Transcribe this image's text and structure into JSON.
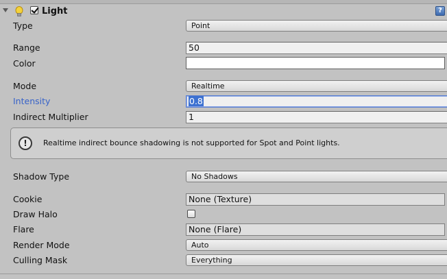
{
  "component": {
    "title": "Light",
    "enabled": true,
    "icon": "lightbulb-icon",
    "help_icon": "help-book-icon",
    "help_glyph": "?"
  },
  "fields": {
    "type": {
      "label": "Type",
      "value": "Point"
    },
    "range": {
      "label": "Range",
      "value": "50"
    },
    "color": {
      "label": "Color",
      "value": "#ffffff"
    },
    "mode": {
      "label": "Mode",
      "value": "Realtime"
    },
    "intensity": {
      "label": "Intensity",
      "value": "0.8"
    },
    "indirect_multiplier": {
      "label": "Indirect Multiplier",
      "value": "1"
    },
    "shadow_type": {
      "label": "Shadow Type",
      "value": "No Shadows"
    },
    "cookie": {
      "label": "Cookie",
      "value": "None (Texture)"
    },
    "draw_halo": {
      "label": "Draw Halo",
      "checked": false
    },
    "flare": {
      "label": "Flare",
      "value": "None (Flare)"
    },
    "render_mode": {
      "label": "Render Mode",
      "value": "Auto"
    },
    "culling_mask": {
      "label": "Culling Mask",
      "value": "Everything"
    }
  },
  "help_box": {
    "icon": "info-icon",
    "glyph": "!",
    "text": "Realtime indirect bounce shadowing is not supported for Spot and Point lights."
  },
  "colors": {
    "background": "#c2c2c2",
    "focus_label": "#3863c9",
    "selection": "#3d71d1"
  }
}
